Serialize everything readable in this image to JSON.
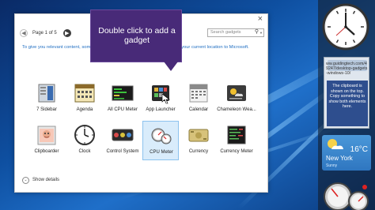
{
  "gallery": {
    "close": "×",
    "page_indicator": "Page 1 of 5",
    "search_placeholder": "Search gadgets",
    "hint": "To give you relevant content, some gadgets might send information to or send your current location to Microsoft.",
    "gadgets": [
      {
        "label": "7 Sidebar",
        "icon": "sidebar-icon",
        "selected": false
      },
      {
        "label": "Agenda",
        "icon": "agenda-icon",
        "selected": false
      },
      {
        "label": "All CPU Meter",
        "icon": "cpu-meter-icon",
        "selected": false
      },
      {
        "label": "App Launcher",
        "icon": "app-launcher-icon",
        "selected": false
      },
      {
        "label": "Calendar",
        "icon": "calendar-icon",
        "selected": false
      },
      {
        "label": "Chameleon Wea...",
        "icon": "weather-icon",
        "selected": false
      },
      {
        "label": "Clipboarder",
        "icon": "clipboard-icon",
        "selected": false
      },
      {
        "label": "Clock",
        "icon": "clock-icon",
        "selected": false
      },
      {
        "label": "Control System",
        "icon": "control-system-icon",
        "selected": false
      },
      {
        "label": "CPU Meter",
        "icon": "gauge-icon",
        "selected": true
      },
      {
        "label": "Currency",
        "icon": "currency-icon",
        "selected": false
      },
      {
        "label": "Currency Meter",
        "icon": "currency-meter-icon",
        "selected": false
      }
    ],
    "show_details": "Show details"
  },
  "tooltip": {
    "text": "Double click to add a gadget"
  },
  "desktop_gadgets": {
    "clipboard_url": "ww.guidingtech.com/49247/desktop-gadgets-windows-10/",
    "clipboard_text": "The clipboard is shown on the top. Copy something to show both elements here.",
    "weather_temp": "16°C",
    "weather_city": "New York",
    "weather_cond": "Sunny"
  },
  "colors": {
    "accent": "#482a78",
    "link": "#1f6ec2",
    "selection": "#d9ecfb"
  }
}
